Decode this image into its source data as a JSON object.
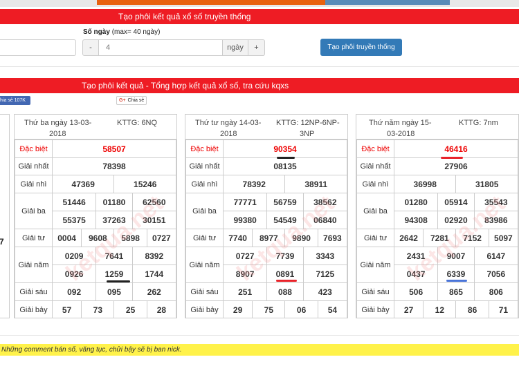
{
  "bars": {
    "traditional_title": "Tạo phôi kết quả xổ số truyền thống",
    "summary_title": "Tạo phôi kết quả - Tổng hợp kết quả xổ số, tra cứu kqxs"
  },
  "form": {
    "days_label": "Số ngày",
    "days_hint": "(max= 40 ngày)",
    "minus": "-",
    "days_value": "4",
    "unit": "ngày",
    "plus": "+",
    "create_button": "Tạo phôi truyền thống"
  },
  "share": {
    "facebook": "hia sẻ 107K",
    "google_g": "G+",
    "google": "Chia sẻ"
  },
  "labels": [
    "Đặc biệt",
    "Giải nhất",
    "Giải nhì",
    "Giải ba",
    "Giải tư",
    "Giải năm",
    "Giải sáu",
    "Giải bảy"
  ],
  "panels": [
    {
      "date_line1": "Thứ ba ngày 13-03-",
      "date_line2": "2018",
      "kttg_line1": "KTTG: 6NQ",
      "kttg_line2": "",
      "special": "58507",
      "first": "78398",
      "second": [
        "47369",
        "15246"
      ],
      "third": [
        "51446",
        "01180",
        "62560",
        "55375",
        "37263",
        "30151"
      ],
      "fourth": [
        "0004",
        "9608",
        "5898",
        "0727"
      ],
      "fifth": [
        "0209",
        "7641",
        "8392",
        "0926",
        "1259",
        "1744"
      ],
      "sixth": [
        "092",
        "095",
        "262"
      ],
      "seventh": [
        "57",
        "73",
        "25",
        "28"
      ]
    },
    {
      "date_line1": "Thứ tư ngày 14-03-",
      "date_line2": "2018",
      "kttg_line1": "KTTG: 12NP-6NP-",
      "kttg_line2": "3NP",
      "special": "90354",
      "first": "08135",
      "second": [
        "78392",
        "38911"
      ],
      "third": [
        "77771",
        "56759",
        "38562",
        "99380",
        "54549",
        "06840"
      ],
      "fourth": [
        "7740",
        "8977",
        "9890",
        "7693"
      ],
      "fifth": [
        "0727",
        "7739",
        "3343",
        "8907",
        "0891",
        "7125"
      ],
      "sixth": [
        "251",
        "088",
        "423"
      ],
      "seventh": [
        "29",
        "75",
        "06",
        "54"
      ]
    },
    {
      "date_line1": "Thứ năm ngày 15-",
      "date_line2": "03-2018",
      "kttg_line1": "KTTG: 7nm",
      "kttg_line2": "",
      "special": "46416",
      "first": "27906",
      "second": [
        "36998",
        "31805"
      ],
      "third": [
        "01280",
        "05914",
        "35543",
        "94308",
        "02920",
        "83986"
      ],
      "fourth": [
        "2642",
        "7281",
        "7152",
        "5097"
      ],
      "fifth": [
        "2431",
        "9007",
        "6147",
        "0437",
        "6339",
        "7056"
      ],
      "sixth": [
        "506",
        "865",
        "806"
      ],
      "seventh": [
        "27",
        "12",
        "86",
        "71"
      ]
    }
  ],
  "left_edge": {
    "fourth_tail": "7"
  },
  "watermark": "ketqua.net",
  "notice": "Những comment bán số, văng tục, chửi bậy sẽ bị ban nick."
}
